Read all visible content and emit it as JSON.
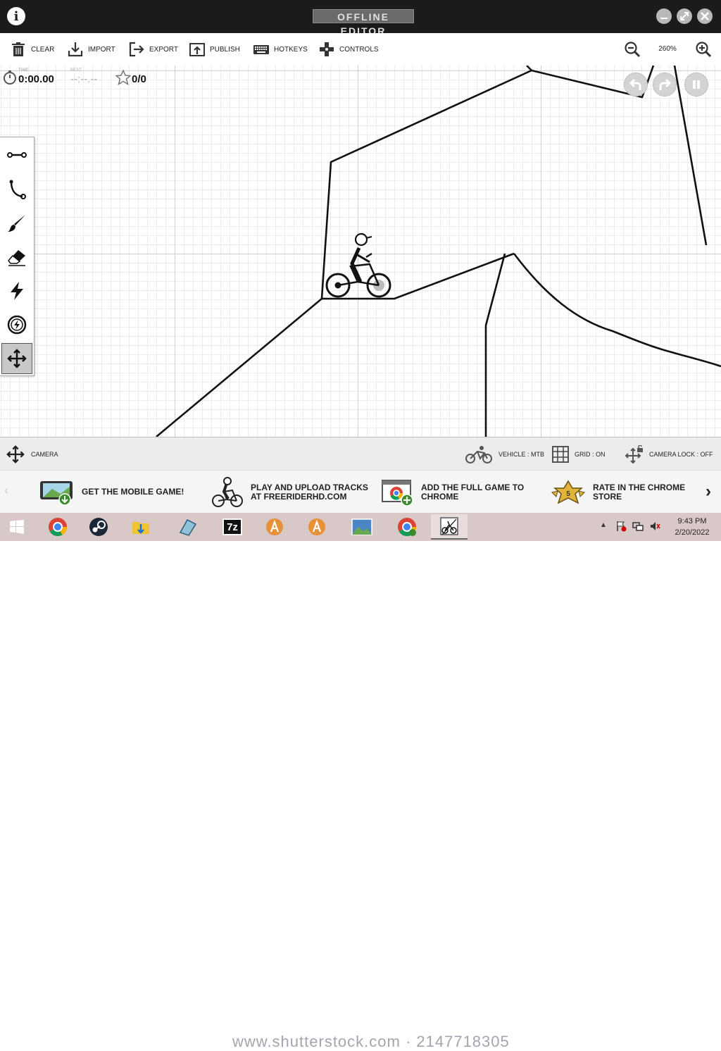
{
  "window": {
    "title": "OFFLINE EDITOR"
  },
  "toolbar": {
    "clear": "CLEAR",
    "import": "IMPORT",
    "export": "EXPORT",
    "publish": "PUBLISH",
    "hotkeys": "HOTKEYS",
    "controls": "CONTROLS",
    "zoom_level": "260%"
  },
  "hud": {
    "time_label": "TIME:",
    "time_value": "0:00.00",
    "best_label": "BEST:",
    "best_value": "--:--.--",
    "stars": "0/0"
  },
  "tools": [
    "straight-line",
    "curve",
    "brush",
    "eraser",
    "boost",
    "gravity",
    "camera-move"
  ],
  "statusbar": {
    "camera": "CAMERA",
    "vehicle": "VEHICLE : MTB",
    "grid": "GRID : ON",
    "camera_lock": "CAMERA LOCK : OFF"
  },
  "promos": [
    {
      "text": "GET THE MOBILE GAME!"
    },
    {
      "text": "PLAY AND UPLOAD TRACKS AT FREERIDERHD.COM"
    },
    {
      "text": "ADD THE FULL GAME TO CHROME"
    },
    {
      "text": "RATE IN THE CHROME STORE",
      "badge": "5"
    }
  ],
  "taskbar": {
    "time": "9:43 PM",
    "date": "2/20/2022",
    "watermark": "www.shutterstock.com · 2147718305"
  },
  "colors": {
    "titlebar": "#1b1b1b",
    "taskbar": "#d9c8c8",
    "grid_major": "#cfcfcf",
    "grid_minor": "#ececec"
  }
}
